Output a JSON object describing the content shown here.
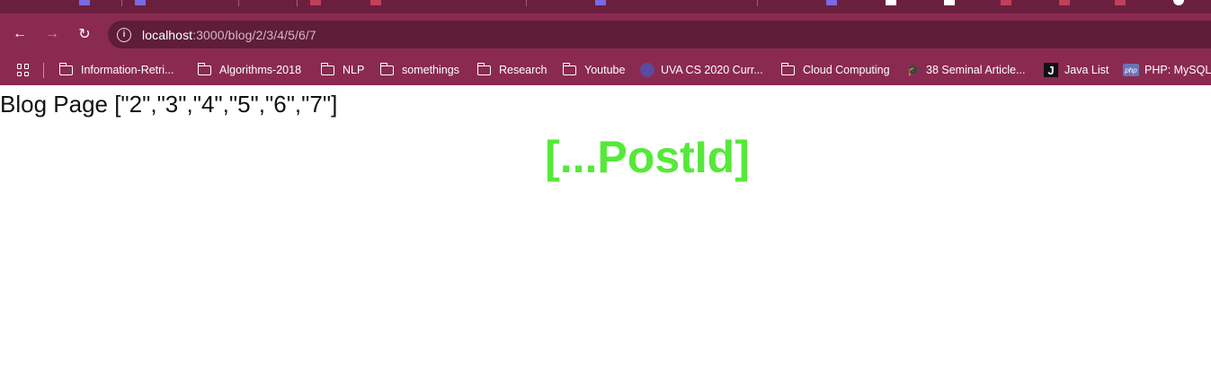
{
  "browser": {
    "tab_strip_colors": [
      "#7a6ae0",
      "#c0405a",
      "#7a6ae0",
      "#ffffff",
      "#c0405a"
    ],
    "address_bar": {
      "host": "localhost",
      "path": ":3000/blog/2/3/4/5/6/7"
    },
    "toolbar": {
      "back_icon": "←",
      "forward_icon": "→",
      "reload_icon": "↻",
      "info_icon": "i"
    },
    "bookmarks": [
      {
        "label": "Information-Retri...",
        "icon": "folder-icon"
      },
      {
        "label": "Algorithms-2018",
        "icon": "folder-icon"
      },
      {
        "label": "NLP",
        "icon": "folder-icon"
      },
      {
        "label": "somethings",
        "icon": "folder-icon"
      },
      {
        "label": "Research",
        "icon": "folder-icon"
      },
      {
        "label": "Youtube",
        "icon": "folder-icon"
      },
      {
        "label": "UVA CS 2020 Curr...",
        "icon": "uva-icon"
      },
      {
        "label": "Cloud Computing",
        "icon": "folder-icon"
      },
      {
        "label": "38 Seminal Article...",
        "icon": "graduation-cap-icon"
      },
      {
        "label": "Java List",
        "icon": "j-icon",
        "icon_text": "J"
      },
      {
        "label": "PHP: MySQL",
        "icon": "php-icon",
        "icon_text": "php"
      }
    ]
  },
  "page": {
    "heading": "Blog Page [\"2\",\"3\",\"4\",\"5\",\"6\",\"7\"]",
    "post_id": "[...PostId]",
    "post_id_color": "#56e83a"
  }
}
